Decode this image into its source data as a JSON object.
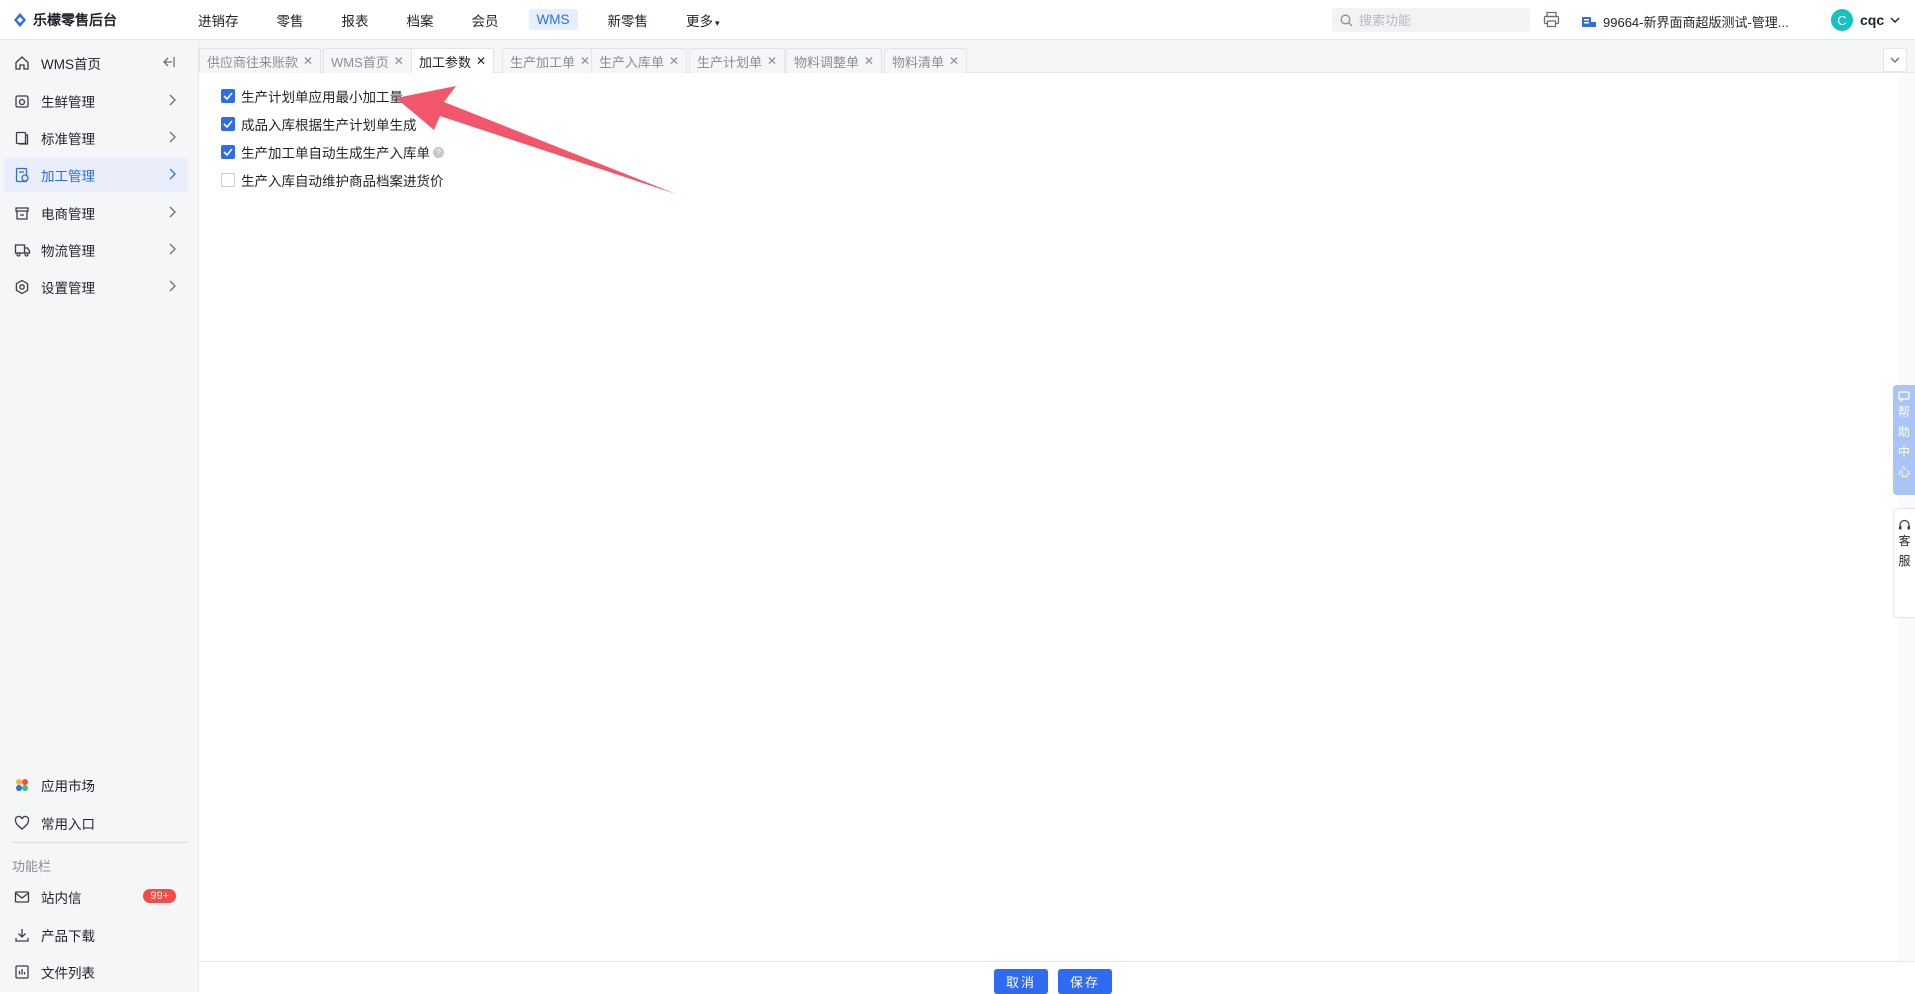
{
  "brand": {
    "name": "乐檬零售后台"
  },
  "topnav": [
    {
      "label": "进销存"
    },
    {
      "label": "零售"
    },
    {
      "label": "报表"
    },
    {
      "label": "档案"
    },
    {
      "label": "会员"
    },
    {
      "label": "WMS",
      "active": true
    },
    {
      "label": "新零售"
    },
    {
      "label": "更多"
    }
  ],
  "search": {
    "placeholder": "搜索功能"
  },
  "store": {
    "label": "99664-新界面商超版测试-管理..."
  },
  "user": {
    "initial": "C",
    "name": "cqc"
  },
  "sidebar": {
    "items": [
      {
        "label": "WMS首页",
        "icon": "home-icon"
      },
      {
        "label": "生鲜管理",
        "icon": "fresh-icon"
      },
      {
        "label": "标准管理",
        "icon": "standard-icon"
      },
      {
        "label": "加工管理",
        "icon": "processing-icon",
        "active": true
      },
      {
        "label": "电商管理",
        "icon": "shop-icon"
      },
      {
        "label": "物流管理",
        "icon": "truck-icon"
      },
      {
        "label": "设置管理",
        "icon": "settings-icon"
      }
    ],
    "bottom": [
      {
        "label": "应用市场",
        "icon": "app-market-icon"
      },
      {
        "label": "常用入口",
        "icon": "heart-icon"
      }
    ],
    "section_label": "功能栏",
    "func": [
      {
        "label": "站内信",
        "icon": "mail-icon",
        "badge": "99+"
      },
      {
        "label": "产品下载",
        "icon": "download-icon"
      },
      {
        "label": "文件列表",
        "icon": "file-list-icon"
      }
    ]
  },
  "tabs": [
    {
      "label": "供应商往来账款"
    },
    {
      "label": "WMS首页"
    },
    {
      "label": "加工参数",
      "active": true
    },
    {
      "label": "生产加工单"
    },
    {
      "label": "生产入库单"
    },
    {
      "label": "生产计划单"
    },
    {
      "label": "物料调整单"
    },
    {
      "label": "物料清单"
    }
  ],
  "options": [
    {
      "label": "生产计划单应用最小加工量",
      "checked": true
    },
    {
      "label": "成品入库根据生产计划单生成",
      "checked": true
    },
    {
      "label": "生产加工单自动生成生产入库单",
      "checked": true,
      "help": true
    },
    {
      "label": "生产入库自动维护商品档案进货价",
      "checked": false
    }
  ],
  "footer": {
    "cancel": "取消",
    "save": "保存"
  },
  "float": {
    "help": [
      "帮",
      "助",
      "中",
      "心"
    ],
    "service": [
      "客",
      "服"
    ]
  },
  "colors": {
    "accent": "#2f6bf0",
    "annotation_arrow": "#f2566b",
    "badge": "#f54a45"
  }
}
